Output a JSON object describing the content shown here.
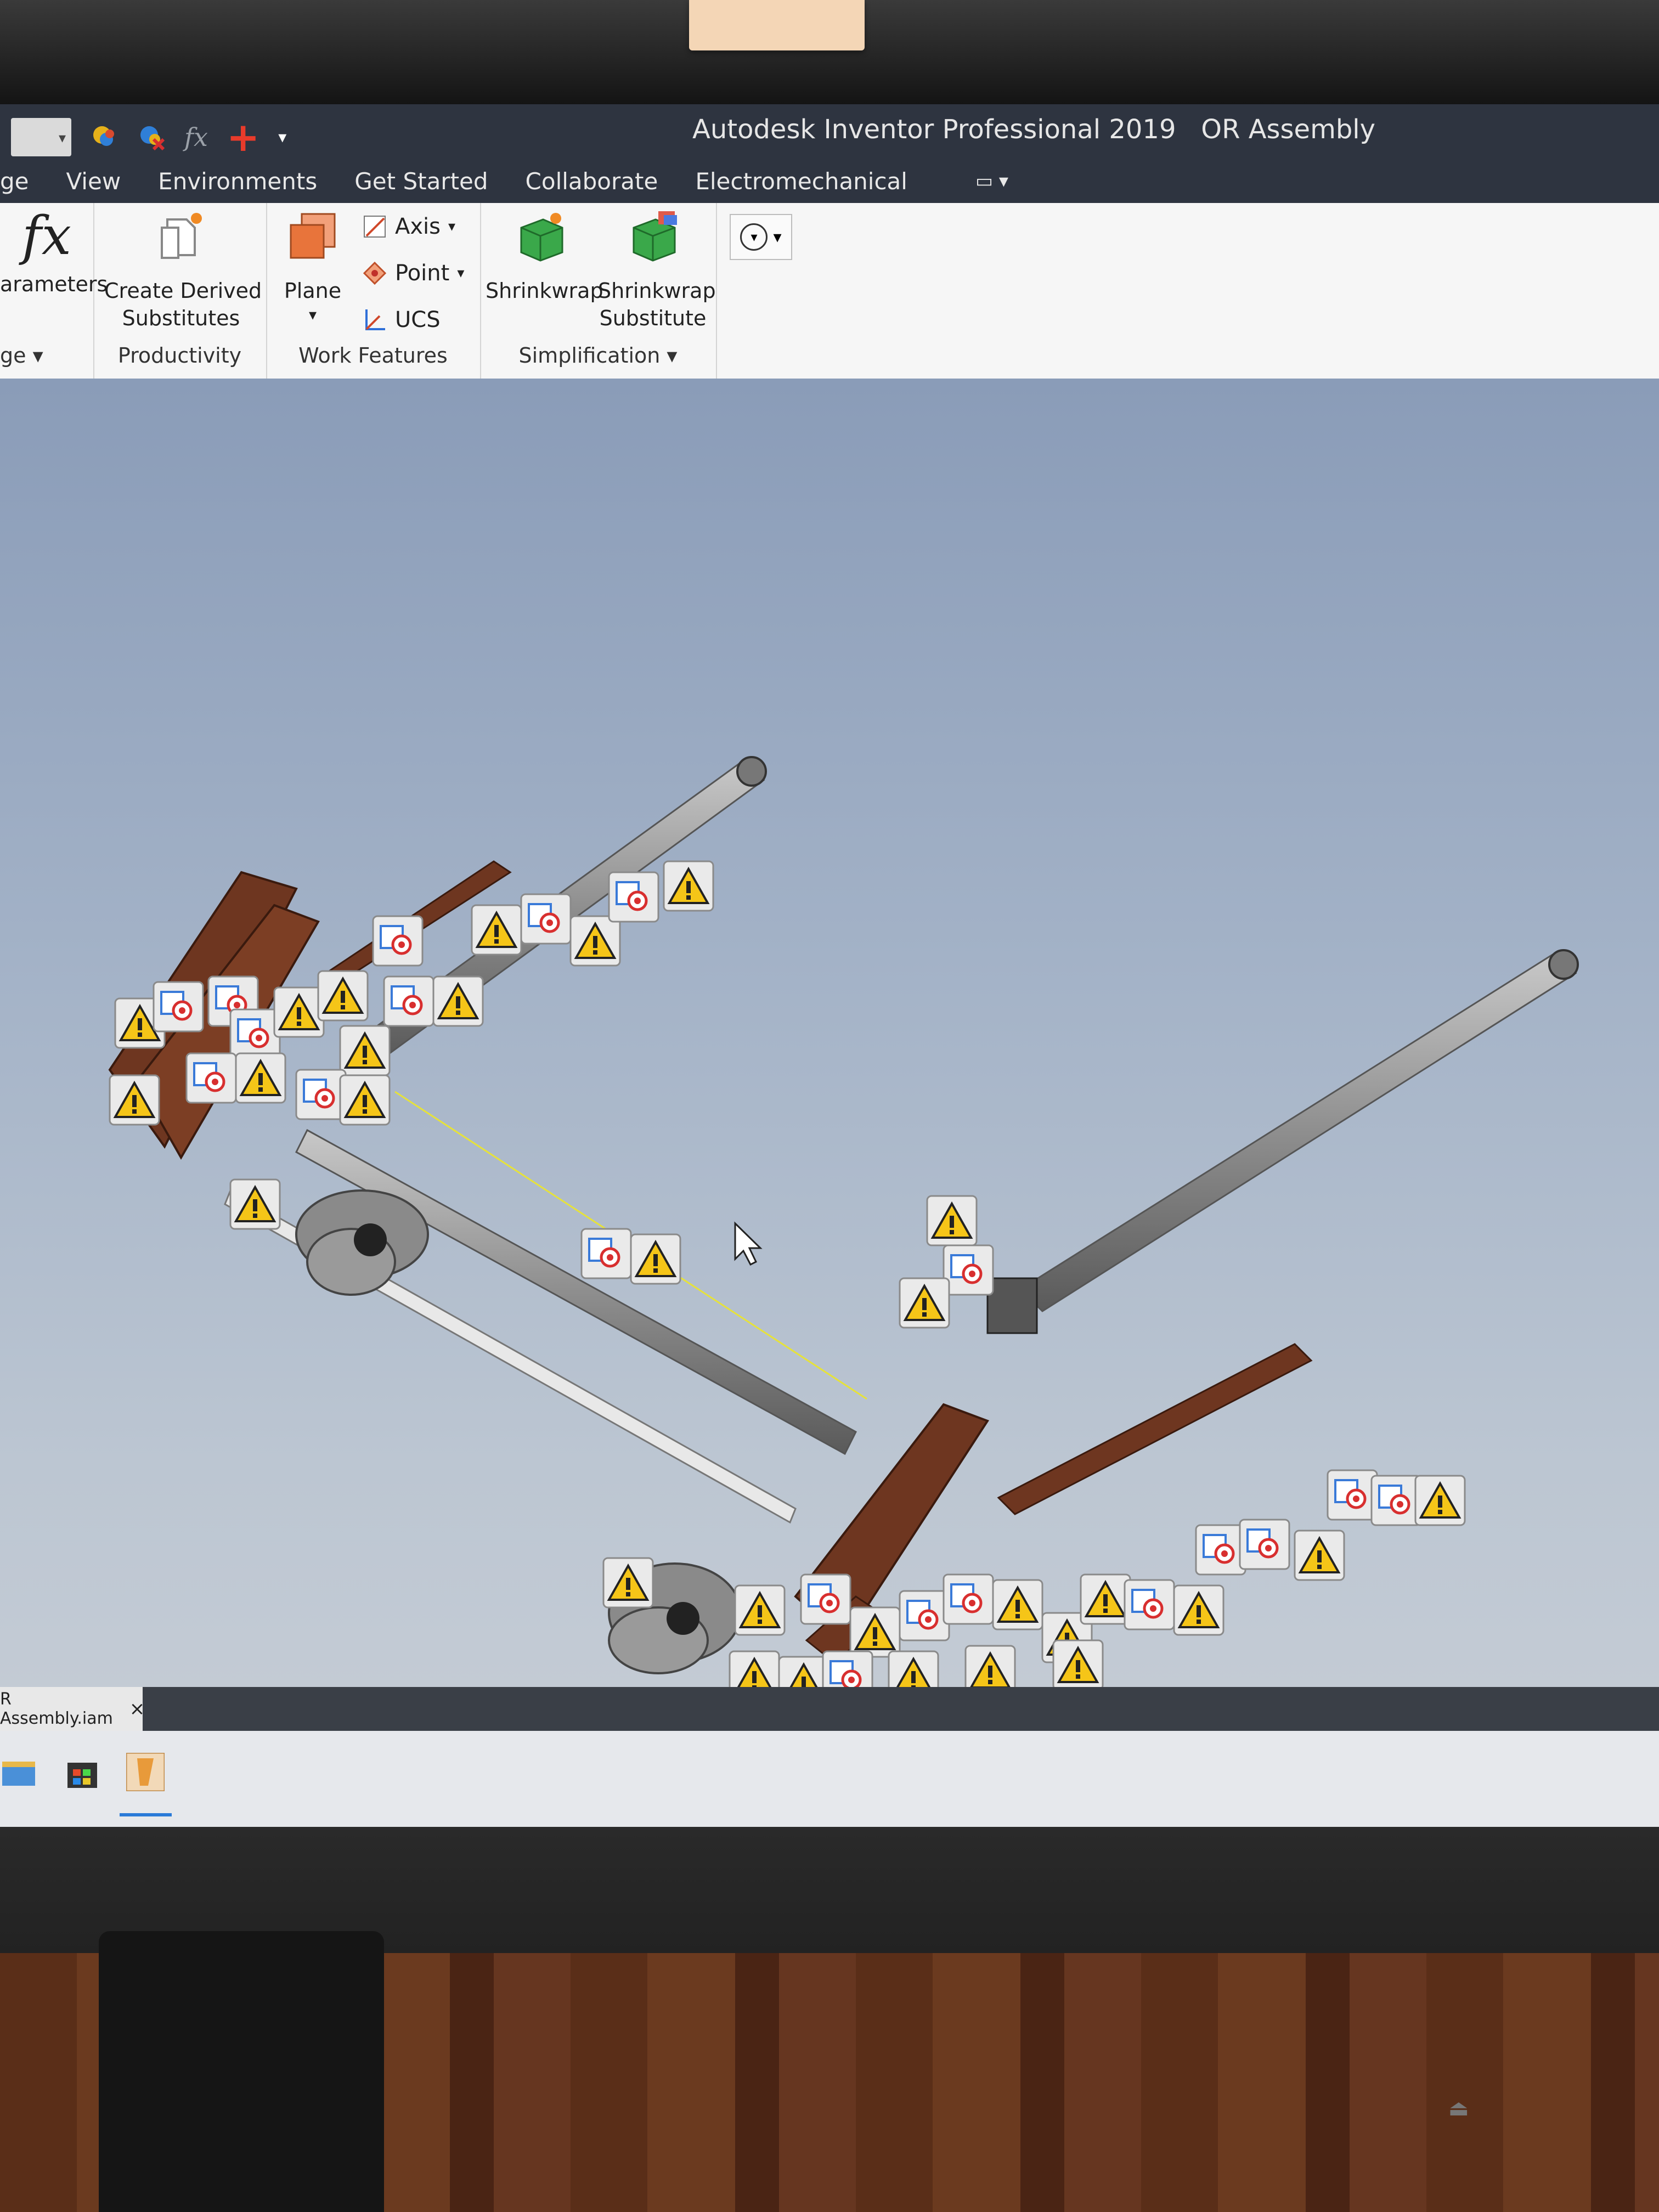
{
  "app": {
    "title": "Autodesk Inventor Professional 2019",
    "document": "OR Assembly"
  },
  "ribbon_tabs": [
    "ge",
    "View",
    "Environments",
    "Get Started",
    "Collaborate",
    "Electromechanical"
  ],
  "ribbon": {
    "parameters_label": "arameters",
    "manage_label": "ge",
    "create_derived_line1": "Create Derived",
    "create_derived_line2": "Substitutes",
    "productivity_label": "Productivity",
    "plane_label": "Plane",
    "axis_label": "Axis",
    "point_label": "Point",
    "ucs_label": "UCS",
    "work_features_label": "Work Features",
    "shrinkwrap_label": "Shrinkwrap",
    "shrinkwrap_sub_line1": "Shrinkwrap",
    "shrinkwrap_sub_line2": "Substitute",
    "simplification_label": "Simplification"
  },
  "document_tab": {
    "label": "R Assembly.iam",
    "close": "×"
  },
  "icons": [
    "fx-icon",
    "plus-icon",
    "plane-icon",
    "axis-icon",
    "point-icon",
    "ucs-icon",
    "shrinkwrap-icon",
    "shrinkwrap-substitute-icon",
    "warning-icon",
    "constraint-icon",
    "mouse-cursor-icon",
    "file-explorer-icon",
    "store-icon",
    "inventor-app-icon"
  ],
  "colors": {
    "title_bar": "#2e3440",
    "viewport_top": "#8a9cb8",
    "warning_yellow": "#f5c518",
    "frame_brown": "#6e3620",
    "rod_gray": "#8e8e8e"
  }
}
